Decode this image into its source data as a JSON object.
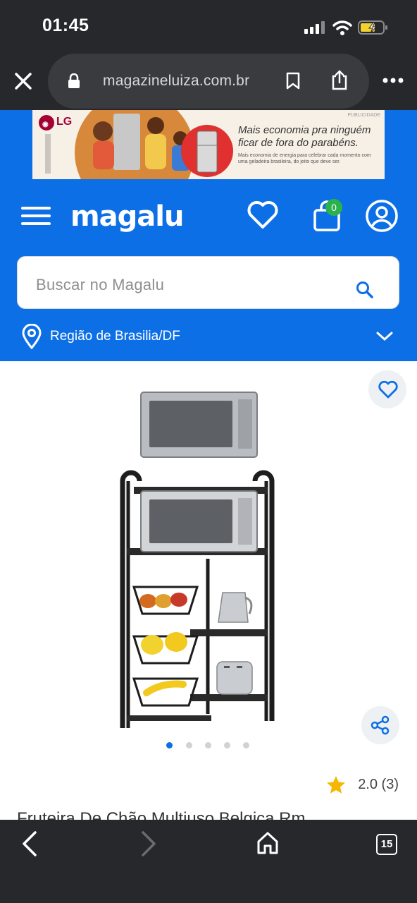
{
  "status_bar": {
    "time": "01:45"
  },
  "browser": {
    "url": "magazineluiza.com.br"
  },
  "ad": {
    "brand": "LG",
    "label": "PUBLICIDADE",
    "headline": "Mais economia pra ninguém ficar de fora do parabéns.",
    "subtext": "Mais economia de energia para celebrar cada momento com uma geladeira brasileira, do jeito que deve ser."
  },
  "header": {
    "logo": "magalu",
    "cart_count": "0",
    "search_placeholder": "Buscar no Magalu",
    "region": "Região de Brasilia/DF"
  },
  "product": {
    "rating": "2.0 (3)",
    "title": "Fruteira De Chão Multiuso Belgica Rm",
    "gallery_dots": 5,
    "active_dot": 0
  },
  "toolbar": {
    "tabs_count": "15"
  },
  "colors": {
    "brand_blue": "#0d6fe6",
    "chrome": "#27282c",
    "star": "#f5b800",
    "badge": "#2bb24c"
  }
}
